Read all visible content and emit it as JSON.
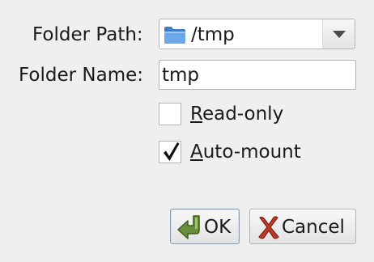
{
  "form": {
    "folder_path_label": "Folder Path:",
    "folder_path_value": "/tmp",
    "folder_name_label": "Folder Name:",
    "folder_name_value": "tmp",
    "read_only": {
      "label_mnemonic": "R",
      "label_rest": "ead-only",
      "checked": false
    },
    "auto_mount": {
      "label_mnemonic": "A",
      "label_rest": "uto-mount",
      "checked": true
    }
  },
  "buttons": {
    "ok_label": "OK",
    "cancel_label": "Cancel"
  },
  "icons": {
    "folder": "folder-icon",
    "dropdown": "chevron-down-icon",
    "ok": "green-return-arrow-icon",
    "cancel": "red-x-icon",
    "check": "checkmark-icon"
  },
  "colors": {
    "background": "#efefef",
    "folder_icon_blue": "#4a90d9",
    "ok_icon_green": "#6a8f3c",
    "cancel_icon_red": "#c0392b"
  }
}
